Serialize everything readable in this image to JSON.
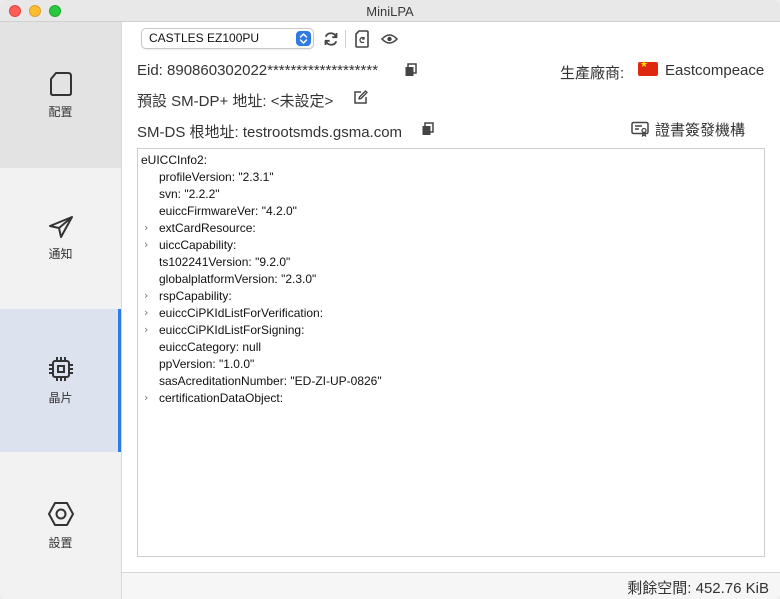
{
  "window": {
    "title": "MiniLPA"
  },
  "sidebar": {
    "items": [
      {
        "id": "config",
        "label": "配置",
        "icon": "card-icon"
      },
      {
        "id": "notify",
        "label": "通知",
        "icon": "paper-plane-icon"
      },
      {
        "id": "chip",
        "label": "晶片",
        "icon": "chip-icon"
      },
      {
        "id": "settings",
        "label": "設置",
        "icon": "hexagon-gear-icon"
      }
    ],
    "active": "chip",
    "accent": "#2f7be5"
  },
  "toolbar": {
    "reader_value": "CASTLES EZ100PU",
    "refresh_icon": "refresh-icon",
    "sim_icon": "sim-card-icon",
    "eye_icon": "eye-icon"
  },
  "info": {
    "eid": "Eid: 890860302022*******************",
    "manufacturer_label": "生產廠商:",
    "manufacturer_name": "Eastcompeace",
    "default_smdp": "預設 SM-DP+ 地址: <未設定>",
    "smds_root": "SM-DS 根地址: testrootsmds.gsma.com",
    "ci_button": "證書簽發機構"
  },
  "tree": {
    "root": "eUICCInfo2:",
    "rows": [
      {
        "text": "profileVersion: \"2.3.1\"",
        "expandable": false
      },
      {
        "text": "svn: \"2.2.2\"",
        "expandable": false
      },
      {
        "text": "euiccFirmwareVer: \"4.2.0\"",
        "expandable": false
      },
      {
        "text": "extCardResource:",
        "expandable": true
      },
      {
        "text": "uiccCapability:",
        "expandable": true
      },
      {
        "text": "ts102241Version: \"9.2.0\"",
        "expandable": false
      },
      {
        "text": "globalplatformVersion: \"2.3.0\"",
        "expandable": false
      },
      {
        "text": "rspCapability:",
        "expandable": true
      },
      {
        "text": "euiccCiPKIdListForVerification:",
        "expandable": true
      },
      {
        "text": "euiccCiPKIdListForSigning:",
        "expandable": true
      },
      {
        "text": "euiccCategory: null",
        "expandable": false
      },
      {
        "text": "ppVersion: \"1.0.0\"",
        "expandable": false
      },
      {
        "text": "sasAcreditationNumber: \"ED-ZI-UP-0826\"",
        "expandable": false
      },
      {
        "text": "certificationDataObject:",
        "expandable": true
      }
    ]
  },
  "status": {
    "free_space": "剩餘空間: 452.76 KiB"
  }
}
